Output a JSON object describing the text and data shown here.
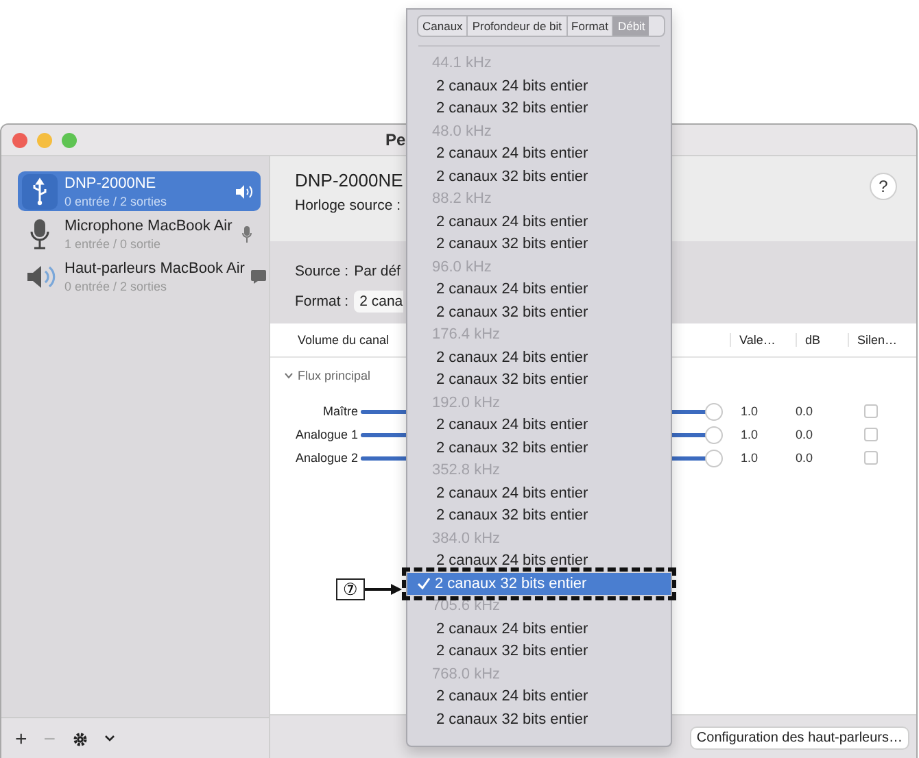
{
  "window": {
    "title": "Pe"
  },
  "sidebar": {
    "devices": [
      {
        "kind": "usb",
        "name": "DNP-2000NE",
        "io": "0 entrée / 2 sorties",
        "selected": true
      },
      {
        "kind": "microphone",
        "name": "Microphone MacBook Air",
        "io": "1 entrée / 0 sortie",
        "selected": false
      },
      {
        "kind": "speaker",
        "name": "Haut-parleurs MacBook Air",
        "io": "0 entrée / 2 sorties",
        "selected": false
      }
    ],
    "toolbar": {
      "add": "+",
      "remove": "−"
    }
  },
  "device": {
    "name": "DNP-2000NE",
    "clock_label": "Horloge source :",
    "help": "?"
  },
  "source": {
    "label": "Source :",
    "value": "Par déf"
  },
  "format": {
    "label": "Format :",
    "value": "2 cana"
  },
  "table": {
    "columns": [
      "Volume du canal",
      "Vale…",
      "dB",
      "Silen…"
    ],
    "group": {
      "label": "Flux principal",
      "expanded": true
    },
    "channels": [
      {
        "name": "Maître",
        "level": 1,
        "value": "1.0",
        "db": "0.0",
        "muted": false
      },
      {
        "name": "Analogue 1",
        "level": 1,
        "value": "1.0",
        "db": "0.0",
        "muted": false
      },
      {
        "name": "Analogue 2",
        "level": 1,
        "value": "1.0",
        "db": "0.0",
        "muted": false
      }
    ]
  },
  "config_button": "Configuration des haut-parleurs…",
  "menu": {
    "tabs": [
      {
        "label": "Canaux",
        "selected": false
      },
      {
        "label": "Profondeur de bit",
        "selected": false
      },
      {
        "label": "Format",
        "selected": false
      },
      {
        "label": "Débit",
        "selected": true
      }
    ],
    "sections": [
      {
        "rate": "44.1 kHz",
        "items": [
          {
            "label": "2 canaux 24 bits entier",
            "selected": false
          },
          {
            "label": "2 canaux 32 bits entier",
            "selected": false
          }
        ]
      },
      {
        "rate": "48.0 kHz",
        "items": [
          {
            "label": "2 canaux 24 bits entier",
            "selected": false
          },
          {
            "label": "2 canaux 32 bits entier",
            "selected": false
          }
        ]
      },
      {
        "rate": "88.2 kHz",
        "items": [
          {
            "label": "2 canaux 24 bits entier",
            "selected": false
          },
          {
            "label": "2 canaux 32 bits entier",
            "selected": false
          }
        ]
      },
      {
        "rate": "96.0 kHz",
        "items": [
          {
            "label": "2 canaux 24 bits entier",
            "selected": false
          },
          {
            "label": "2 canaux 32 bits entier",
            "selected": false
          }
        ]
      },
      {
        "rate": "176.4 kHz",
        "items": [
          {
            "label": "2 canaux 24 bits entier",
            "selected": false
          },
          {
            "label": "2 canaux 32 bits entier",
            "selected": false
          }
        ]
      },
      {
        "rate": "192.0 kHz",
        "items": [
          {
            "label": "2 canaux 24 bits entier",
            "selected": false
          },
          {
            "label": "2 canaux 32 bits entier",
            "selected": false
          }
        ]
      },
      {
        "rate": "352.8 kHz",
        "items": [
          {
            "label": "2 canaux 24 bits entier",
            "selected": false
          },
          {
            "label": "2 canaux 32 bits entier",
            "selected": false
          }
        ]
      },
      {
        "rate": "384.0 kHz",
        "items": [
          {
            "label": "2 canaux 24 bits entier",
            "selected": false
          },
          {
            "label": "2 canaux 32 bits entier",
            "selected": true
          }
        ]
      },
      {
        "rate": "705.6 kHz",
        "items": [
          {
            "label": "2 canaux 24 bits entier",
            "selected": false
          },
          {
            "label": "2 canaux 32 bits entier",
            "selected": false
          }
        ]
      },
      {
        "rate": "768.0 kHz",
        "items": [
          {
            "label": "2 canaux 24 bits entier",
            "selected": false
          },
          {
            "label": "2 canaux 32 bits entier",
            "selected": false
          }
        ]
      }
    ]
  },
  "callout": {
    "label": "⑦"
  }
}
